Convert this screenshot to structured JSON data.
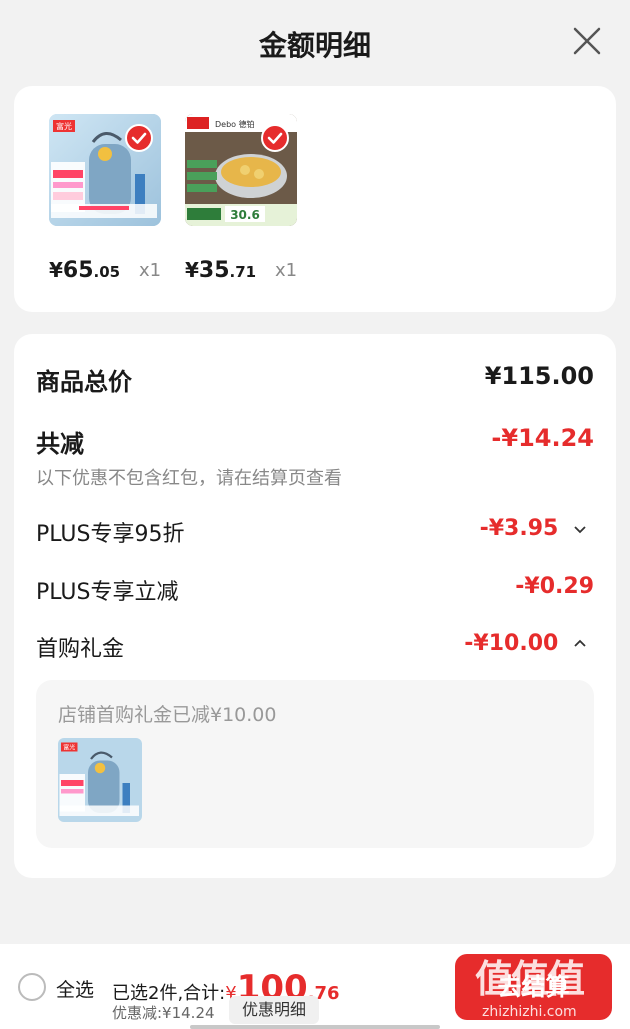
{
  "header": {
    "title": "金额明细"
  },
  "colors": {
    "accent": "#e62c2c",
    "muted": "#888888"
  },
  "products": [
    {
      "brand_label": "富光",
      "price_yen": "¥",
      "price_int": "65",
      "price_dec": ".05",
      "qty": "x1",
      "image_icon": "water-bottle-product-image"
    },
    {
      "brand_label": "Debo 德铂",
      "promo_label": "30.6",
      "price_yen": "¥",
      "price_int": "35",
      "price_dec": ".71",
      "qty": "x1",
      "image_icon": "cooking-pot-product-image"
    }
  ],
  "summary": {
    "total_label": "商品总价",
    "total_value": "¥115.00",
    "discount_label": "共减",
    "discount_value": "-¥14.24",
    "note": "以下优惠不包含红包，请在结算页查看",
    "items": [
      {
        "label": "PLUS专享95折",
        "value": "-¥3.95"
      },
      {
        "label": "PLUS专享立减",
        "value": "-¥0.29"
      },
      {
        "label": "首购礼金",
        "value": "-¥10.00"
      }
    ],
    "gift_note": "店铺首购礼金已减¥10.00",
    "gift_brand": "富光"
  },
  "footer": {
    "select_all": "全选",
    "selected_text": "已选2件,合计:",
    "total_yen": "¥",
    "total_int": "100",
    "total_dec": ".76",
    "saved_text": "优惠减:¥14.24",
    "detail_button": "优惠明细",
    "pay_button": "去结算",
    "watermark": "值值值",
    "watermark_url": "zhizhizhi.com"
  }
}
